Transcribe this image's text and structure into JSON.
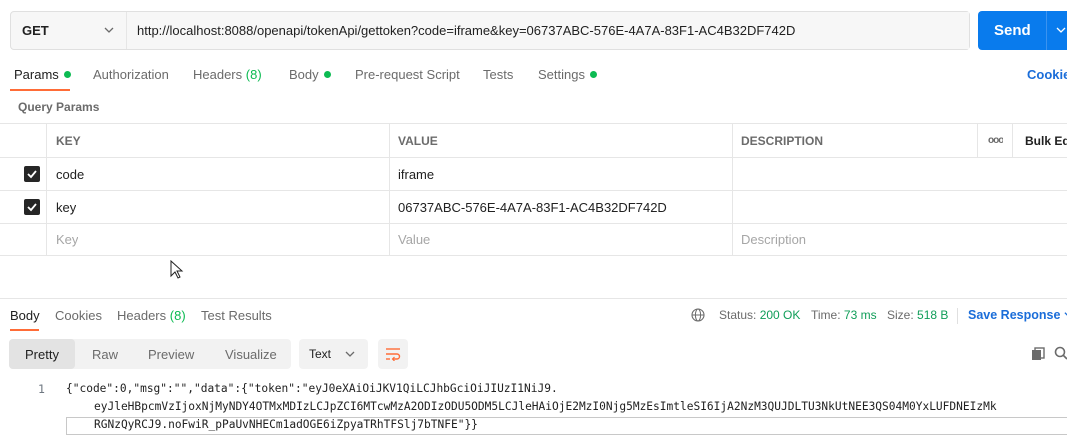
{
  "request": {
    "method": "GET",
    "url": "http://localhost:8088/openapi/tokenApi/gettoken?code=iframe&key=06737ABC-576E-4A7A-83F1-AC4B32DF742D",
    "send_label": "Send"
  },
  "req_tabs": {
    "params": "Params",
    "authorization": "Authorization",
    "headers": "Headers",
    "headers_count": "(8)",
    "body": "Body",
    "pre_request": "Pre-request Script",
    "tests": "Tests",
    "settings": "Settings",
    "cookies": "Cookies"
  },
  "query_params": {
    "title": "Query Params",
    "columns": {
      "key": "KEY",
      "value": "VALUE",
      "description": "DESCRIPTION",
      "more": "ooo",
      "bulk": "Bulk Edit"
    },
    "rows": [
      {
        "checked": true,
        "key": "code",
        "value": "iframe",
        "description": ""
      },
      {
        "checked": true,
        "key": "key",
        "value": "06737ABC-576E-4A7A-83F1-AC4B32DF742D",
        "description": ""
      }
    ],
    "placeholder": {
      "key": "Key",
      "value": "Value",
      "description": "Description"
    }
  },
  "response": {
    "tabs": {
      "body": "Body",
      "cookies": "Cookies",
      "headers": "Headers",
      "headers_count": "(8)",
      "test_results": "Test Results"
    },
    "status_label": "Status:",
    "status_value": "200 OK",
    "time_label": "Time:",
    "time_value": "73 ms",
    "size_label": "Size:",
    "size_value": "518 B",
    "save_label": "Save Response",
    "views": {
      "pretty": "Pretty",
      "raw": "Raw",
      "preview": "Preview",
      "visualize": "Visualize"
    },
    "format": "Text",
    "line_number": "1",
    "body_lines": [
      "{\"code\":0,\"msg\":\"\",\"data\":{\"token\":\"eyJ0eXAiOiJKV1QiLCJhbGciOiJIUzI1NiJ9.",
      "eyJleHBpcmVzIjoxNjMyNDY4OTMxMDIzLCJpZCI6MTcwMzA2ODIzODU5ODM5LCJleHAiOjE2MzI0Njg5MzEsImtleSI6IjA2NzM3QUJDLTU3NkUtNEE3QS04M0YxLUFDNEIzMk",
      "RGNzQyRCJ9.noFwiR_pPaUvNHECm1adOGE6iZpyaTRhTFSlj7bTNFE\"}}"
    ]
  }
}
